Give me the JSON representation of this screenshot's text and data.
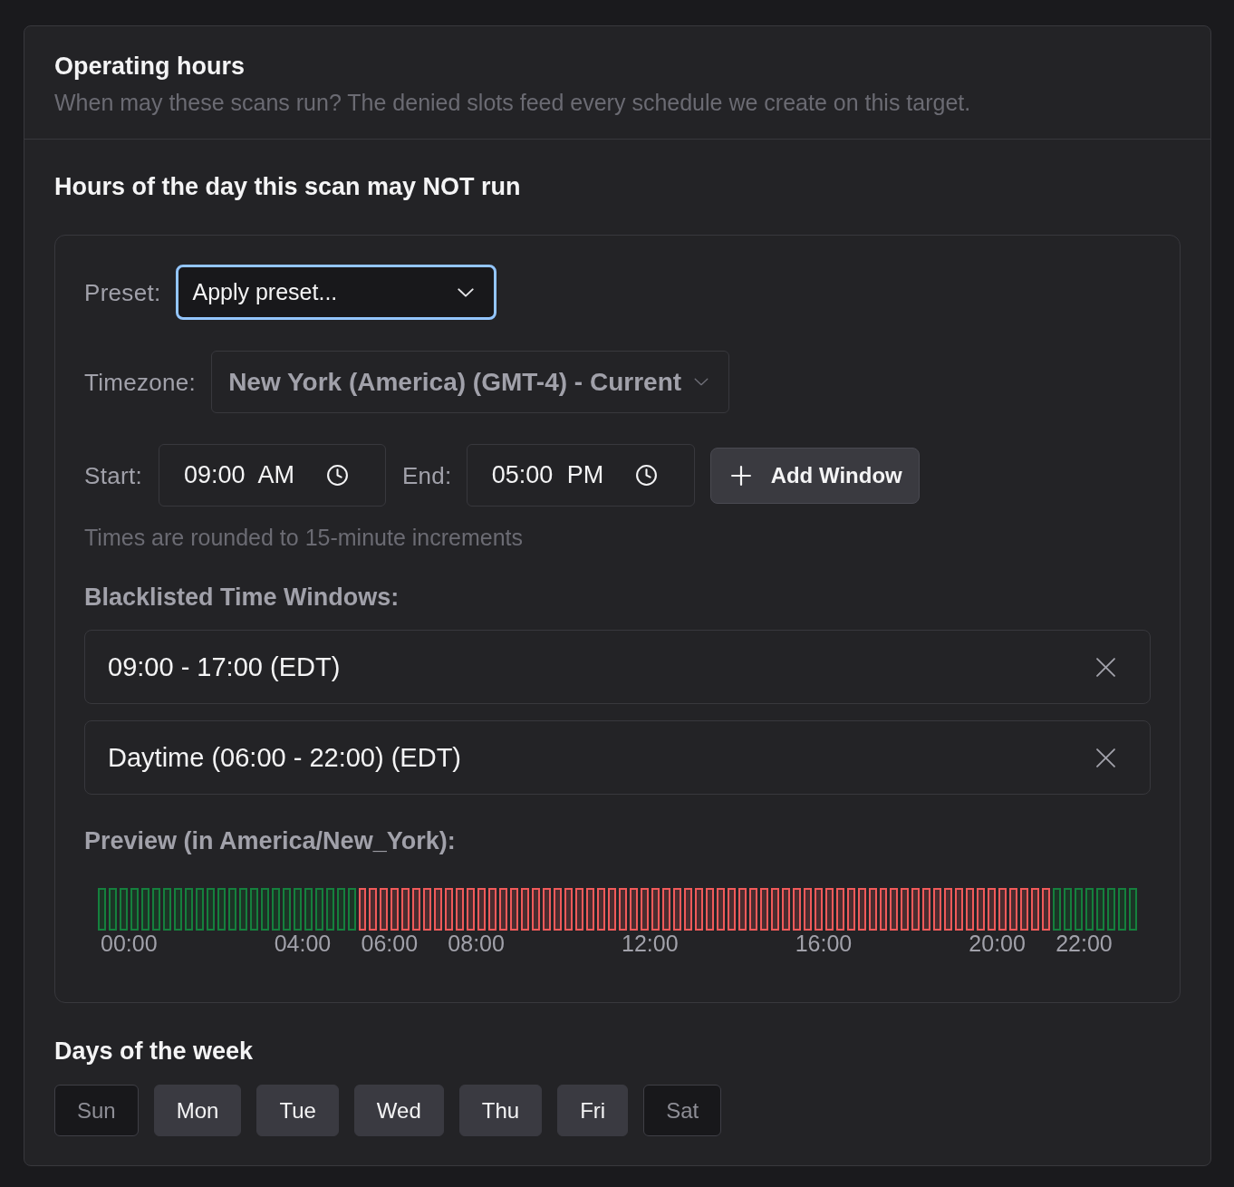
{
  "header": {
    "title": "Operating hours",
    "subtitle": "When may these scans run? The denied slots feed every schedule we create on this target."
  },
  "section": {
    "title": "Hours of the day this scan may NOT run"
  },
  "preset": {
    "label": "Preset:",
    "value": "Apply preset...",
    "focused": true
  },
  "timezone": {
    "label": "Timezone:",
    "value": "New York (America) (GMT-4) - Current"
  },
  "start": {
    "label": "Start:",
    "value": "09:00 AM"
  },
  "end": {
    "label": "End:",
    "value": "05:00 PM"
  },
  "add_button": {
    "label": "Add Window"
  },
  "hint": "Times are rounded to 15-minute increments",
  "windows": {
    "title": "Blacklisted Time Windows:",
    "items": [
      {
        "label": "09:00 - 17:00 (EDT)"
      },
      {
        "label": "Daytime (06:00 - 22:00) (EDT)"
      }
    ]
  },
  "preview": {
    "title": "Preview (in America/New_York):",
    "slots": [
      {
        "blocked": false,
        "label": "00:00"
      },
      {
        "blocked": false
      },
      {
        "blocked": false
      },
      {
        "blocked": false
      },
      {
        "blocked": false
      },
      {
        "blocked": false
      },
      {
        "blocked": false
      },
      {
        "blocked": false
      },
      {
        "blocked": false
      },
      {
        "blocked": false
      },
      {
        "blocked": false
      },
      {
        "blocked": false
      },
      {
        "blocked": false
      },
      {
        "blocked": false
      },
      {
        "blocked": false
      },
      {
        "blocked": false
      },
      {
        "blocked": false,
        "label": "04:00"
      },
      {
        "blocked": false
      },
      {
        "blocked": false
      },
      {
        "blocked": false
      },
      {
        "blocked": false
      },
      {
        "blocked": false
      },
      {
        "blocked": false
      },
      {
        "blocked": false
      },
      {
        "blocked": true,
        "label": "06:00"
      },
      {
        "blocked": true
      },
      {
        "blocked": true
      },
      {
        "blocked": true
      },
      {
        "blocked": true
      },
      {
        "blocked": true
      },
      {
        "blocked": true
      },
      {
        "blocked": true
      },
      {
        "blocked": true,
        "label": "08:00"
      },
      {
        "blocked": true
      },
      {
        "blocked": true
      },
      {
        "blocked": true
      },
      {
        "blocked": true
      },
      {
        "blocked": true
      },
      {
        "blocked": true
      },
      {
        "blocked": true
      },
      {
        "blocked": true
      },
      {
        "blocked": true
      },
      {
        "blocked": true
      },
      {
        "blocked": true
      },
      {
        "blocked": true
      },
      {
        "blocked": true
      },
      {
        "blocked": true
      },
      {
        "blocked": true
      },
      {
        "blocked": true,
        "label": "12:00"
      },
      {
        "blocked": true
      },
      {
        "blocked": true
      },
      {
        "blocked": true
      },
      {
        "blocked": true
      },
      {
        "blocked": true
      },
      {
        "blocked": true
      },
      {
        "blocked": true
      },
      {
        "blocked": true
      },
      {
        "blocked": true
      },
      {
        "blocked": true
      },
      {
        "blocked": true
      },
      {
        "blocked": true
      },
      {
        "blocked": true
      },
      {
        "blocked": true
      },
      {
        "blocked": true
      },
      {
        "blocked": true,
        "label": "16:00"
      },
      {
        "blocked": true
      },
      {
        "blocked": true
      },
      {
        "blocked": true
      },
      {
        "blocked": true
      },
      {
        "blocked": true
      },
      {
        "blocked": true
      },
      {
        "blocked": true
      },
      {
        "blocked": true
      },
      {
        "blocked": true
      },
      {
        "blocked": true
      },
      {
        "blocked": true
      },
      {
        "blocked": true
      },
      {
        "blocked": true
      },
      {
        "blocked": true
      },
      {
        "blocked": true
      },
      {
        "blocked": true,
        "label": "20:00"
      },
      {
        "blocked": true
      },
      {
        "blocked": true
      },
      {
        "blocked": true
      },
      {
        "blocked": true
      },
      {
        "blocked": true
      },
      {
        "blocked": true
      },
      {
        "blocked": true
      },
      {
        "blocked": false,
        "label": "22:00"
      },
      {
        "blocked": false
      },
      {
        "blocked": false
      },
      {
        "blocked": false
      },
      {
        "blocked": false
      },
      {
        "blocked": false
      },
      {
        "blocked": false
      },
      {
        "blocked": false
      }
    ]
  },
  "days": {
    "title": "Days of the week",
    "items": [
      {
        "label": "Sun",
        "selected": false
      },
      {
        "label": "Mon",
        "selected": true
      },
      {
        "label": "Tue",
        "selected": true
      },
      {
        "label": "Wed",
        "selected": true
      },
      {
        "label": "Thu",
        "selected": true
      },
      {
        "label": "Fri",
        "selected": true
      },
      {
        "label": "Sat",
        "selected": false
      }
    ]
  }
}
